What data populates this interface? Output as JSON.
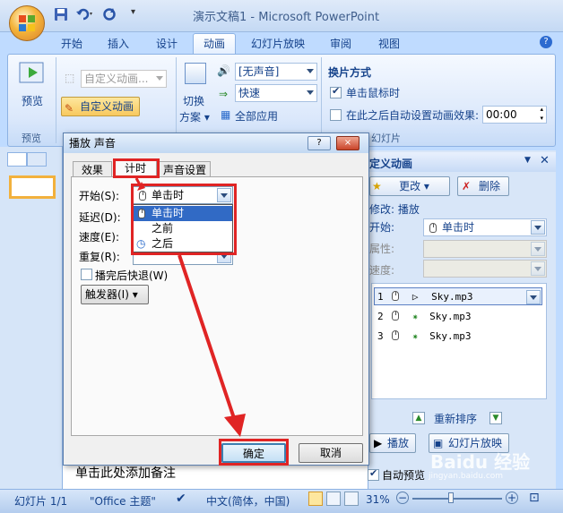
{
  "window": {
    "title": "演示文稿1 - Microsoft PowerPoint"
  },
  "ribbon_tabs": [
    "开始",
    "插入",
    "设计",
    "动画",
    "幻灯片放映",
    "审阅",
    "视图"
  ],
  "ribbon": {
    "preview_group": {
      "button": "预览",
      "label": "预览"
    },
    "custom_anim": {
      "dropdown": "自定义动画...",
      "button": "自定义动画"
    },
    "transition": {
      "scheme_label_1": "切换",
      "scheme_label_2": "方案",
      "sound_value": "[无声音]",
      "speed_value": "快速",
      "apply_all": "全部应用"
    },
    "switch": {
      "title": "换片方式",
      "on_click": "单击鼠标时",
      "auto_after": "在此之后自动设置动画效果:",
      "time_value": "00:00",
      "group_label": "幻灯片"
    }
  },
  "slides_pane": {
    "slide_number": "1"
  },
  "notes_placeholder": "单击此处添加备注",
  "dialog": {
    "title": "播放 声音",
    "help": "?",
    "close": "×",
    "tabs": [
      "效果",
      "计时",
      "声音设置"
    ],
    "fields": {
      "start_label": "开始(S):",
      "start_value": "单击时",
      "delay_label": "延迟(D):",
      "speed_label": "速度(E):",
      "repeat_label": "重复(R):",
      "rewind_label": "播完后快退(W)",
      "trigger_label": "触发器(I)"
    },
    "popup_options": [
      "单击时",
      "之前",
      "之后"
    ],
    "ok": "确定",
    "cancel": "取消"
  },
  "task_pane": {
    "title": "定义动画",
    "change_btn": "更改",
    "delete_btn": "删除",
    "modify_label": "修改: 播放",
    "start_label": "开始:",
    "start_value": "单击时",
    "property_label": "属性:",
    "speed_label": "速度:",
    "items": [
      {
        "num": "1",
        "name": "Sky.mp3"
      },
      {
        "num": "2",
        "name": "Sky.mp3"
      },
      {
        "num": "3",
        "name": "Sky.mp3"
      }
    ],
    "reorder": "重新排序",
    "play_btn": "播放",
    "slideshow_btn": "幻灯片放映",
    "autopreview": "自动预览"
  },
  "statusbar": {
    "slide_info": "幻灯片 1/1",
    "theme": "\"Office 主题\"",
    "language": "中文(简体，中国)",
    "zoom": "31%"
  },
  "watermark": {
    "text": "Baidu 经验",
    "sub": "jingyan.baidu.com"
  }
}
